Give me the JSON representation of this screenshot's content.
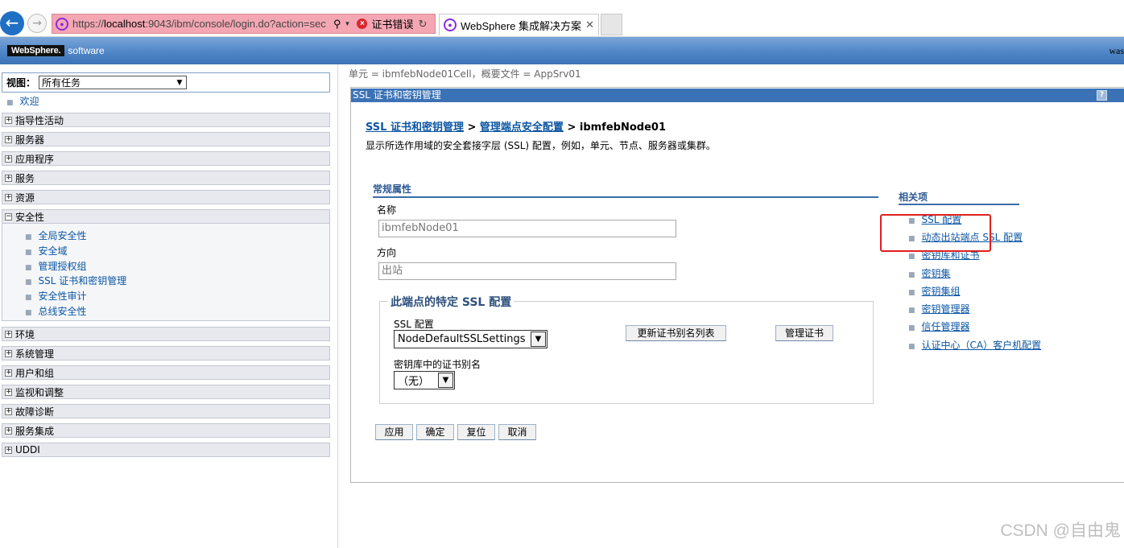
{
  "browser": {
    "url_prefix": "https://",
    "url_host": "localhost",
    "url_rest": ":9043/ibm/console/login.do?action=sec",
    "cert_error": "证书错误",
    "tab_title": "WebSphere 集成解决方案...",
    "close_glyph": "✕"
  },
  "header": {
    "logo": "WebSphere.",
    "logo_suffix": "software",
    "user": "was"
  },
  "nav": {
    "view_label": "视图：",
    "view_selected": "所有任务",
    "welcome": "欢迎",
    "groups_top": [
      {
        "toggle": "+",
        "label": "指导性活动"
      },
      {
        "toggle": "+",
        "label": "服务器"
      },
      {
        "toggle": "+",
        "label": "应用程序"
      },
      {
        "toggle": "+",
        "label": "服务"
      },
      {
        "toggle": "+",
        "label": "资源"
      }
    ],
    "security": {
      "toggle": "−",
      "label": "安全性"
    },
    "security_items": [
      "全局安全性",
      "安全域",
      "管理授权组",
      "SSL 证书和密钥管理",
      "安全性审计",
      "总线安全性"
    ],
    "groups_bottom": [
      {
        "toggle": "+",
        "label": "环境"
      },
      {
        "toggle": "+",
        "label": "系统管理"
      },
      {
        "toggle": "+",
        "label": "用户和组"
      },
      {
        "toggle": "+",
        "label": "监视和调整"
      },
      {
        "toggle": "+",
        "label": "故障诊断"
      },
      {
        "toggle": "+",
        "label": "服务集成"
      },
      {
        "toggle": "+",
        "label": "UDDI"
      }
    ]
  },
  "main": {
    "scope": "单元 = ibmfebNode01Cell，概要文件 = AppSrv01",
    "panel_title": "SSL 证书和密钥管理",
    "help_glyph": "?",
    "breadcrumb": {
      "link1": "SSL 证书和密钥管理",
      "sep": " > ",
      "link2": "管理端点安全配置",
      "current": "ibmfebNode01"
    },
    "description": "显示所选作用域的安全套接字层 (SSL) 配置，例如，单元、节点、服务器或集群。",
    "general_title": "常规属性",
    "name_label": "名称",
    "name_value": "ibmfebNode01",
    "direction_label": "方向",
    "direction_value": "出站",
    "fieldset_legend": "此端点的特定 SSL 配置",
    "ssl_config_label": "SSL 配置",
    "ssl_config_value": "NodeDefaultSSLSettings",
    "alias_label": "密钥库中的证书别名",
    "alias_value": "（无）",
    "update_alias_button": "更新证书别名列表",
    "manage_certs_button": "管理证书",
    "buttons": {
      "apply": "应用",
      "ok": "确定",
      "reset": "复位",
      "cancel": "取消"
    }
  },
  "related": {
    "title": "相关项",
    "items": [
      "SSL 配置",
      "动态出站端点 SSL 配置",
      "密钥库和证书",
      "密钥集",
      "密钥集组",
      "密钥管理器",
      "信任管理器",
      "认证中心（CA）客户机配置"
    ]
  },
  "watermark": "CSDN @自由鬼"
}
